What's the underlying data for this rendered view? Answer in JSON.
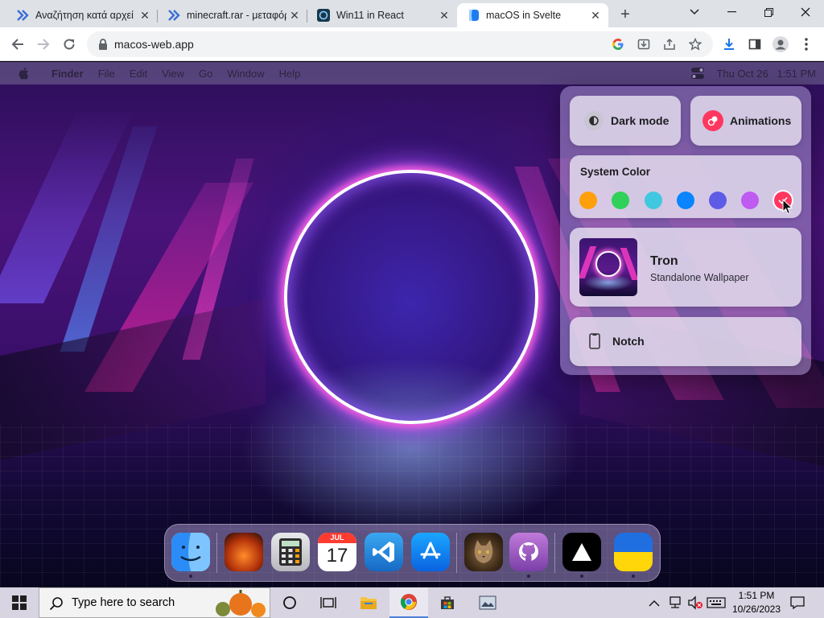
{
  "browser": {
    "tabs": [
      {
        "title": "Αναζήτηση κατά αρχεί"
      },
      {
        "title": "minecraft.rar - μεταφόρ"
      },
      {
        "title": "Win11 in React"
      },
      {
        "title": "macOS in Svelte"
      }
    ],
    "active_tab": 3,
    "url": "macos-web.app"
  },
  "menubar": {
    "app_name": "Finder",
    "items": [
      "File",
      "Edit",
      "View",
      "Go",
      "Window",
      "Help"
    ],
    "datetime": "Thu Oct 26   1:51 PM"
  },
  "control_center": {
    "dark_mode_label": "Dark mode",
    "animations_label": "Animations",
    "system_color_label": "System Color",
    "swatches": [
      "#ff9f0a",
      "#30d158",
      "#40c8e0",
      "#0a84ff",
      "#5e5ce6",
      "#bf5af2",
      "#ff375f"
    ],
    "selected_swatch": 6,
    "wallpaper_title": "Tron",
    "wallpaper_subtitle": "Standalone Wallpaper",
    "notch_label": "Notch"
  },
  "dock": {
    "calendar_month": "JUL",
    "calendar_day": "17"
  },
  "taskbar": {
    "search_placeholder": "Type here to search",
    "time": "1:51 PM",
    "date": "10/26/2023"
  }
}
